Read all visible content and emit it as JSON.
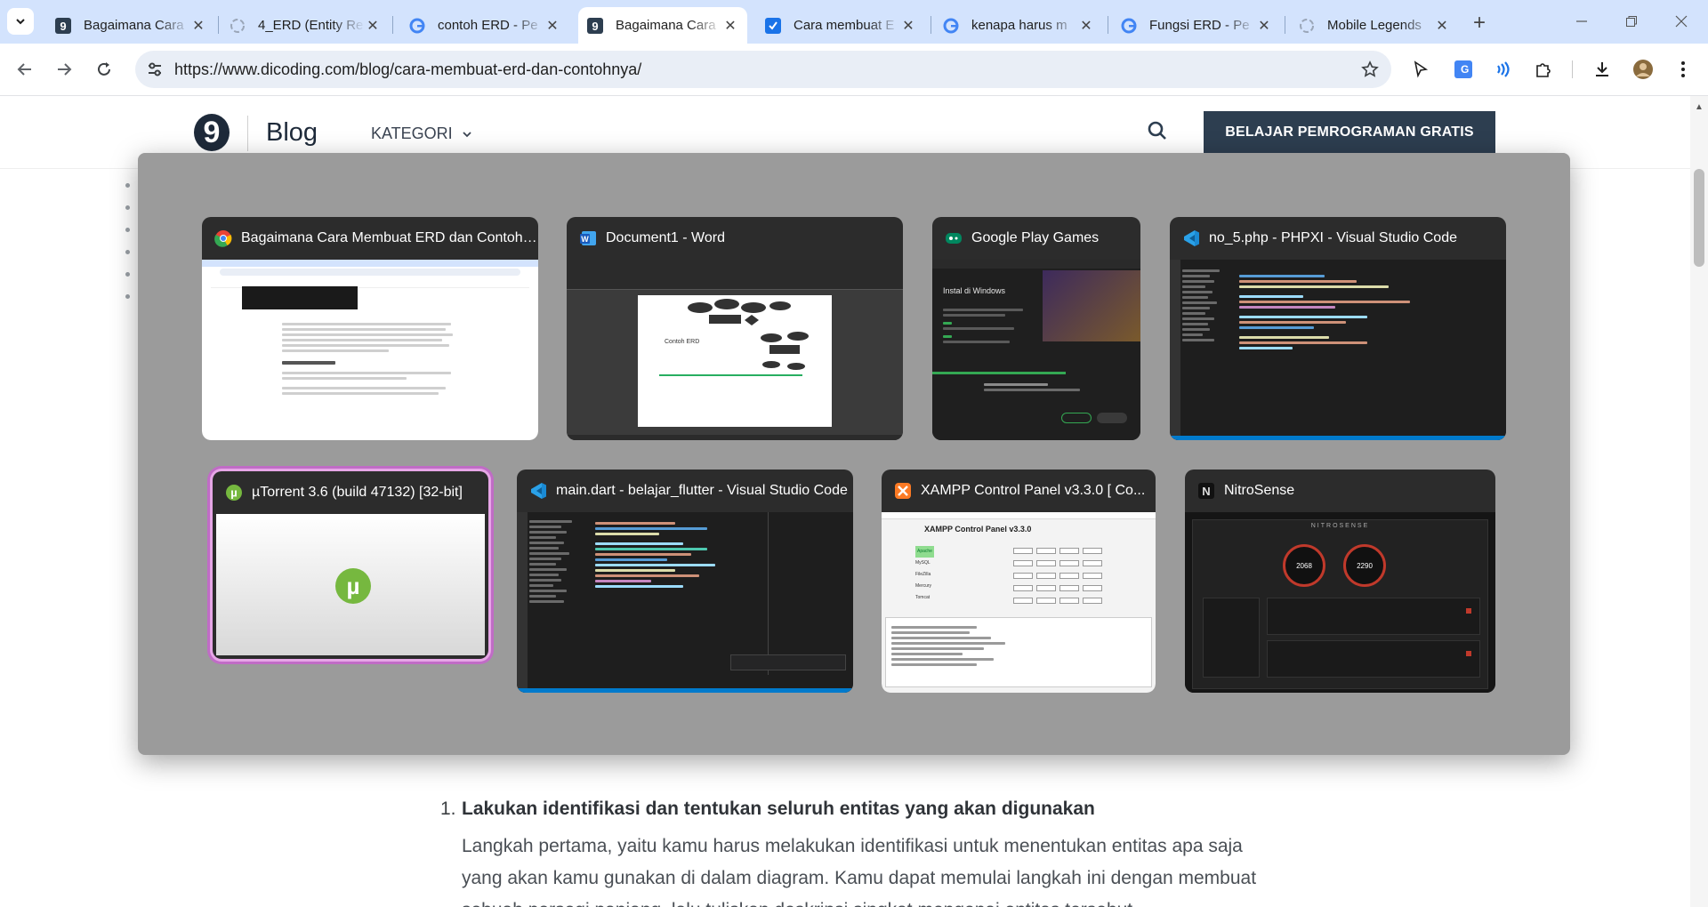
{
  "browser": {
    "tabs": [
      {
        "title": "Bagaimana Cara",
        "favicon": "dicoding-favicon",
        "active": false
      },
      {
        "title": "4_ERD (Entity Re",
        "favicon": "loading-favicon",
        "active": false
      },
      {
        "title": "contoh ERD - Pe",
        "favicon": "google-favicon",
        "active": false
      },
      {
        "title": "Bagaimana Cara",
        "favicon": "dicoding-favicon",
        "active": true
      },
      {
        "title": "Cara membuat E",
        "favicon": "blue-check-favicon",
        "active": false
      },
      {
        "title": "kenapa harus m",
        "favicon": "google-favicon",
        "active": false
      },
      {
        "title": "Fungsi ERD - Pe",
        "favicon": "google-favicon",
        "active": false
      },
      {
        "title": "Mobile Legends",
        "favicon": "loading-favicon",
        "active": false
      }
    ],
    "new_tab_label": "+",
    "url": "https://www.dicoding.com/blog/cara-membuat-erd-dan-contohnya/"
  },
  "site": {
    "logo_letter": "9",
    "blog_label": "Blog",
    "category_label": "KATEGORI",
    "cta_label": "BELAJAR PEMROGRAMAN GRATIS"
  },
  "article": {
    "item_number": "1.",
    "item_title": "Lakukan identifikasi dan tentukan seluruh entitas yang akan digunakan",
    "item_body": "Langkah pertama, yaitu kamu harus melakukan identifikasi untuk menentukan entitas apa saja yang akan kamu gunakan di dalam diagram. Kamu dapat memulai langkah ini dengan membuat sebuah persegi panjang, lalu tuliskan deskripsi singkat mengenai entitas tersebut."
  },
  "switcher": {
    "windows": [
      {
        "title": "Bagaimana Cara Membuat ERD dan Contohn...",
        "icon": "chrome-icon"
      },
      {
        "title": "Document1 - Word",
        "icon": "word-icon"
      },
      {
        "title": "Google Play Games",
        "icon": "google-play-games-icon"
      },
      {
        "title": "no_5.php - PHPXI - Visual Studio Code",
        "icon": "vscode-icon"
      },
      {
        "title": "µTorrent 3.6  (build 47132) [32-bit]",
        "icon": "utorrent-icon",
        "selected": true
      },
      {
        "title": "main.dart - belajar_flutter - Visual Studio Code",
        "icon": "vscode-icon"
      },
      {
        "title": "XAMPP Control Panel v3.3.0   [ Co...",
        "icon": "xampp-icon"
      },
      {
        "title": "NitroSense",
        "icon": "nitrosense-icon"
      }
    ],
    "thumbs": {
      "gpg_heading": "Instal di Windows",
      "xampp_heading": "XAMPP Control Panel v3.3.0",
      "xampp_modules": [
        "Apache",
        "MySQL",
        "FileZilla",
        "Mercury",
        "Tomcat"
      ],
      "nitro_brand": "NITROSENSE",
      "nitro_cpu": "2068",
      "nitro_gpu": "2290"
    }
  }
}
